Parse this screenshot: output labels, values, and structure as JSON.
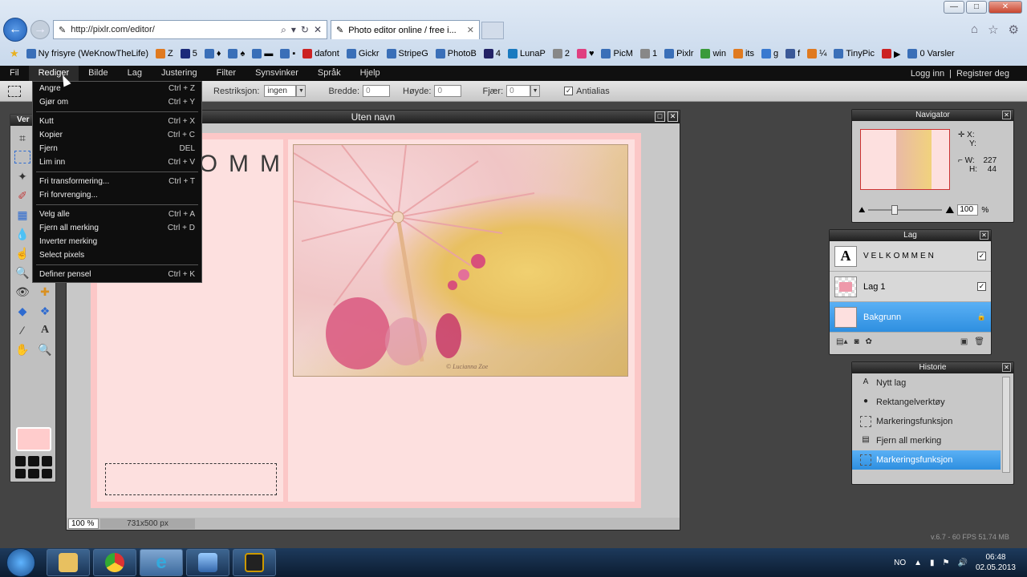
{
  "browser": {
    "url": "http://pixlr.com/editor/",
    "tab_title": "Photo editor online / free i...",
    "favorites": [
      {
        "label": "Ny frisyre (WeKnowTheLife)",
        "color": "#3a6fb8"
      },
      {
        "label": "Z",
        "color": "#e07a20"
      },
      {
        "label": "5",
        "color": "#1b2a7a"
      },
      {
        "label": "♦",
        "color": "#3a6fb8"
      },
      {
        "label": "♠",
        "color": "#3a6fb8"
      },
      {
        "label": "▬",
        "color": "#3a6fb8"
      },
      {
        "label": "▪",
        "color": "#3a6fb8"
      },
      {
        "label": "dafont",
        "color": "#c22"
      },
      {
        "label": "Gickr",
        "color": "#3a6fb8"
      },
      {
        "label": "StripeG",
        "color": "#3a6fb8"
      },
      {
        "label": "PhotoB",
        "color": "#3a6fb8"
      },
      {
        "label": "4",
        "color": "#226"
      },
      {
        "label": "LunaP",
        "color": "#1a7ac0"
      },
      {
        "label": "2",
        "color": "#888"
      },
      {
        "label": "♥",
        "color": "#e04080"
      },
      {
        "label": "PicM",
        "color": "#3a6fb8"
      },
      {
        "label": "1",
        "color": "#888"
      },
      {
        "label": "Pixlr",
        "color": "#3a6fb8"
      },
      {
        "label": "win",
        "color": "#3a9a3a"
      },
      {
        "label": "its",
        "color": "#e07a20"
      },
      {
        "label": "g",
        "color": "#3a7ad0"
      },
      {
        "label": "f",
        "color": "#3b5998"
      },
      {
        "label": "¼",
        "color": "#e07a20"
      },
      {
        "label": "TinyPic",
        "color": "#3a6fb8"
      },
      {
        "label": "▶",
        "color": "#c22"
      },
      {
        "label": "0 Varsler",
        "color": "#3a6fb8"
      }
    ]
  },
  "menubar": {
    "items": [
      "Fil",
      "Rediger",
      "Bilde",
      "Lag",
      "Justering",
      "Filter",
      "Synsvinker",
      "Språk",
      "Hjelp"
    ],
    "login": "Logg inn",
    "separator": "|",
    "register": "Registrer deg"
  },
  "options": {
    "restriction_label": "Restriksjon:",
    "restriction_value": "ingen",
    "width_label": "Bredde:",
    "width_value": "0",
    "height_label": "Høyde:",
    "height_value": "0",
    "feather_label": "Fjær:",
    "feather_value": "0",
    "antialias_label": "Antialias",
    "antialias_checked": true
  },
  "tools_panel": {
    "title": "Ver"
  },
  "edit_menu": {
    "groups": [
      [
        {
          "label": "Angre",
          "shortcut": "Ctrl + Z"
        },
        {
          "label": "Gjør om",
          "shortcut": "Ctrl + Y"
        }
      ],
      [
        {
          "label": "Kutt",
          "shortcut": "Ctrl + X"
        },
        {
          "label": "Kopier",
          "shortcut": "Ctrl + C"
        },
        {
          "label": "Fjern",
          "shortcut": "DEL"
        },
        {
          "label": "Lim inn",
          "shortcut": "Ctrl + V"
        }
      ],
      [
        {
          "label": "Fri transformering...",
          "shortcut": "Ctrl + T"
        },
        {
          "label": "Fri forvrenging...",
          "shortcut": ""
        }
      ],
      [
        {
          "label": "Velg alle",
          "shortcut": "Ctrl + A"
        },
        {
          "label": "Fjern all merking",
          "shortcut": "Ctrl + D"
        },
        {
          "label": "Inverter merking",
          "shortcut": ""
        },
        {
          "label": "Select pixels",
          "shortcut": ""
        }
      ],
      [
        {
          "label": "Definer pensel",
          "shortcut": "Ctrl + K"
        }
      ]
    ]
  },
  "canvas": {
    "title": "Uten navn",
    "heading_text": "VELKOMMEN",
    "zoom": "100 %",
    "size": "731x500 px",
    "photo_watermark": "© Lucianna Zoe",
    "foreground_color": "#ffcccc"
  },
  "navigator": {
    "title": "Navigator",
    "x_label": "X:",
    "y_label": "Y:",
    "w_label": "W:",
    "w_value": "227",
    "h_label": "H:",
    "h_value": "44",
    "zoom_value": "100",
    "zoom_unit": "%",
    "zoom_fraction": 0.35
  },
  "layers": {
    "title": "Lag",
    "items": [
      {
        "name": "VELKOMMEN",
        "thumb": "A",
        "checked": true,
        "selected": false
      },
      {
        "name": "Lag 1",
        "thumb": "img",
        "checked": true,
        "selected": false
      },
      {
        "name": "Bakgrunn",
        "thumb": "bg",
        "checked": false,
        "selected": true,
        "locked": true
      }
    ]
  },
  "history": {
    "title": "Historie",
    "items": [
      {
        "label": "Nytt lag",
        "icon": "A",
        "selected": false
      },
      {
        "label": "Rektangelverktøy",
        "icon": "●",
        "selected": false
      },
      {
        "label": "Markeringsfunksjon",
        "icon": "",
        "selected": false
      },
      {
        "label": "Fjern all merking",
        "icon": "▤",
        "selected": false
      },
      {
        "label": "Markeringsfunksjon",
        "icon": "",
        "selected": true
      }
    ]
  },
  "status": {
    "version": "v.6.7 - 60 FPS 51.74 MB"
  },
  "taskbar": {
    "lang": "NO",
    "time": "06:48",
    "date": "02.05.2013"
  }
}
